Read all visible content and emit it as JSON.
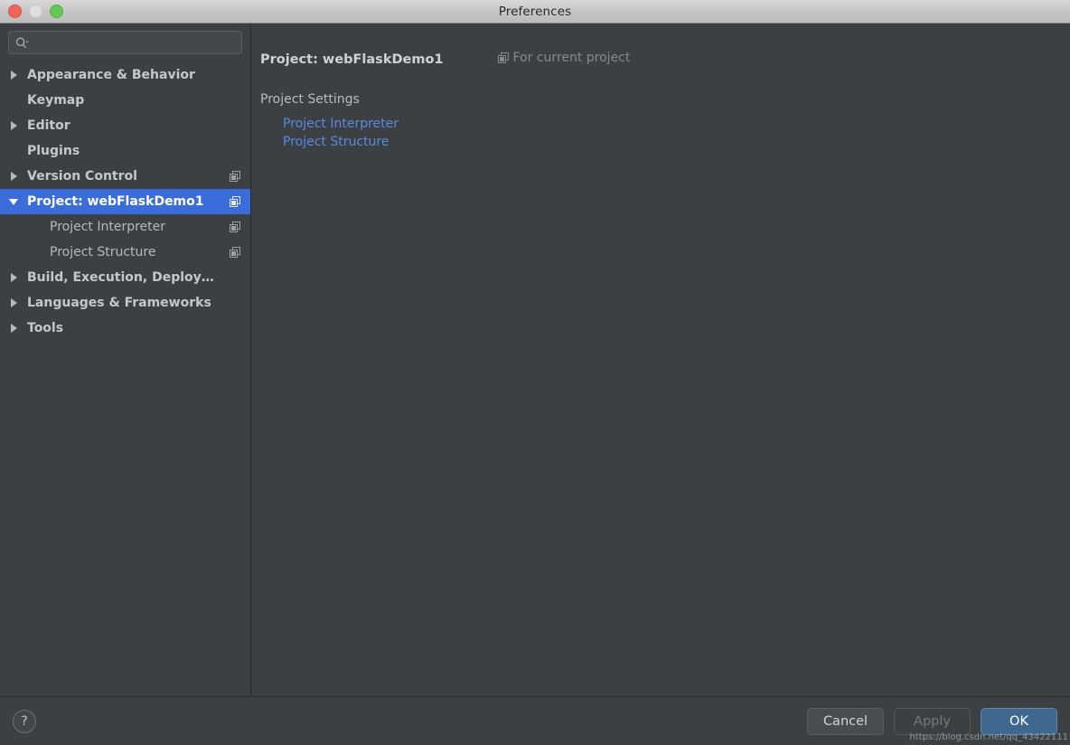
{
  "window": {
    "title": "Preferences",
    "controls": {
      "close": "close",
      "minimize": "minimize",
      "zoom": "zoom"
    }
  },
  "search": {
    "value": "",
    "placeholder": "",
    "icon": "search-icon"
  },
  "sidebar": {
    "items": [
      {
        "label": "Appearance & Behavior",
        "arrow": "right",
        "bold": true,
        "child": false,
        "selected": false,
        "copy_icon": false
      },
      {
        "label": "Keymap",
        "arrow": "none",
        "bold": true,
        "child": false,
        "selected": false,
        "copy_icon": false
      },
      {
        "label": "Editor",
        "arrow": "right",
        "bold": true,
        "child": false,
        "selected": false,
        "copy_icon": false
      },
      {
        "label": "Plugins",
        "arrow": "none",
        "bold": true,
        "child": false,
        "selected": false,
        "copy_icon": false
      },
      {
        "label": "Version Control",
        "arrow": "right",
        "bold": true,
        "child": false,
        "selected": false,
        "copy_icon": true
      },
      {
        "label": "Project: webFlaskDemo1",
        "arrow": "down",
        "bold": true,
        "child": false,
        "selected": true,
        "copy_icon": true
      },
      {
        "label": "Project Interpreter",
        "arrow": "none",
        "bold": false,
        "child": true,
        "selected": false,
        "copy_icon": true
      },
      {
        "label": "Project Structure",
        "arrow": "none",
        "bold": false,
        "child": true,
        "selected": false,
        "copy_icon": true
      },
      {
        "label": "Build, Execution, Deployment",
        "arrow": "right",
        "bold": true,
        "child": false,
        "selected": false,
        "copy_icon": false
      },
      {
        "label": "Languages & Frameworks",
        "arrow": "right",
        "bold": true,
        "child": false,
        "selected": false,
        "copy_icon": false
      },
      {
        "label": "Tools",
        "arrow": "right",
        "bold": true,
        "child": false,
        "selected": false,
        "copy_icon": false
      }
    ]
  },
  "main": {
    "title": "Project: webFlaskDemo1",
    "scope_note": "For current project",
    "scope_icon": "copy-icon",
    "section_label": "Project Settings",
    "links": [
      {
        "label": "Project Interpreter"
      },
      {
        "label": "Project Structure"
      }
    ]
  },
  "footer": {
    "help_label": "?",
    "cancel_label": "Cancel",
    "apply_label": "Apply",
    "ok_label": "OK",
    "apply_enabled": false
  },
  "watermark": "https://blog.csdn.net/qq_43422111",
  "colors": {
    "selection_blue": "#3a6dd9",
    "link_blue": "#5a8ae0",
    "ok_button_blue": "#3f688f",
    "panel_background": "#3c4043",
    "titlebar_text": "#2b2b2b"
  }
}
